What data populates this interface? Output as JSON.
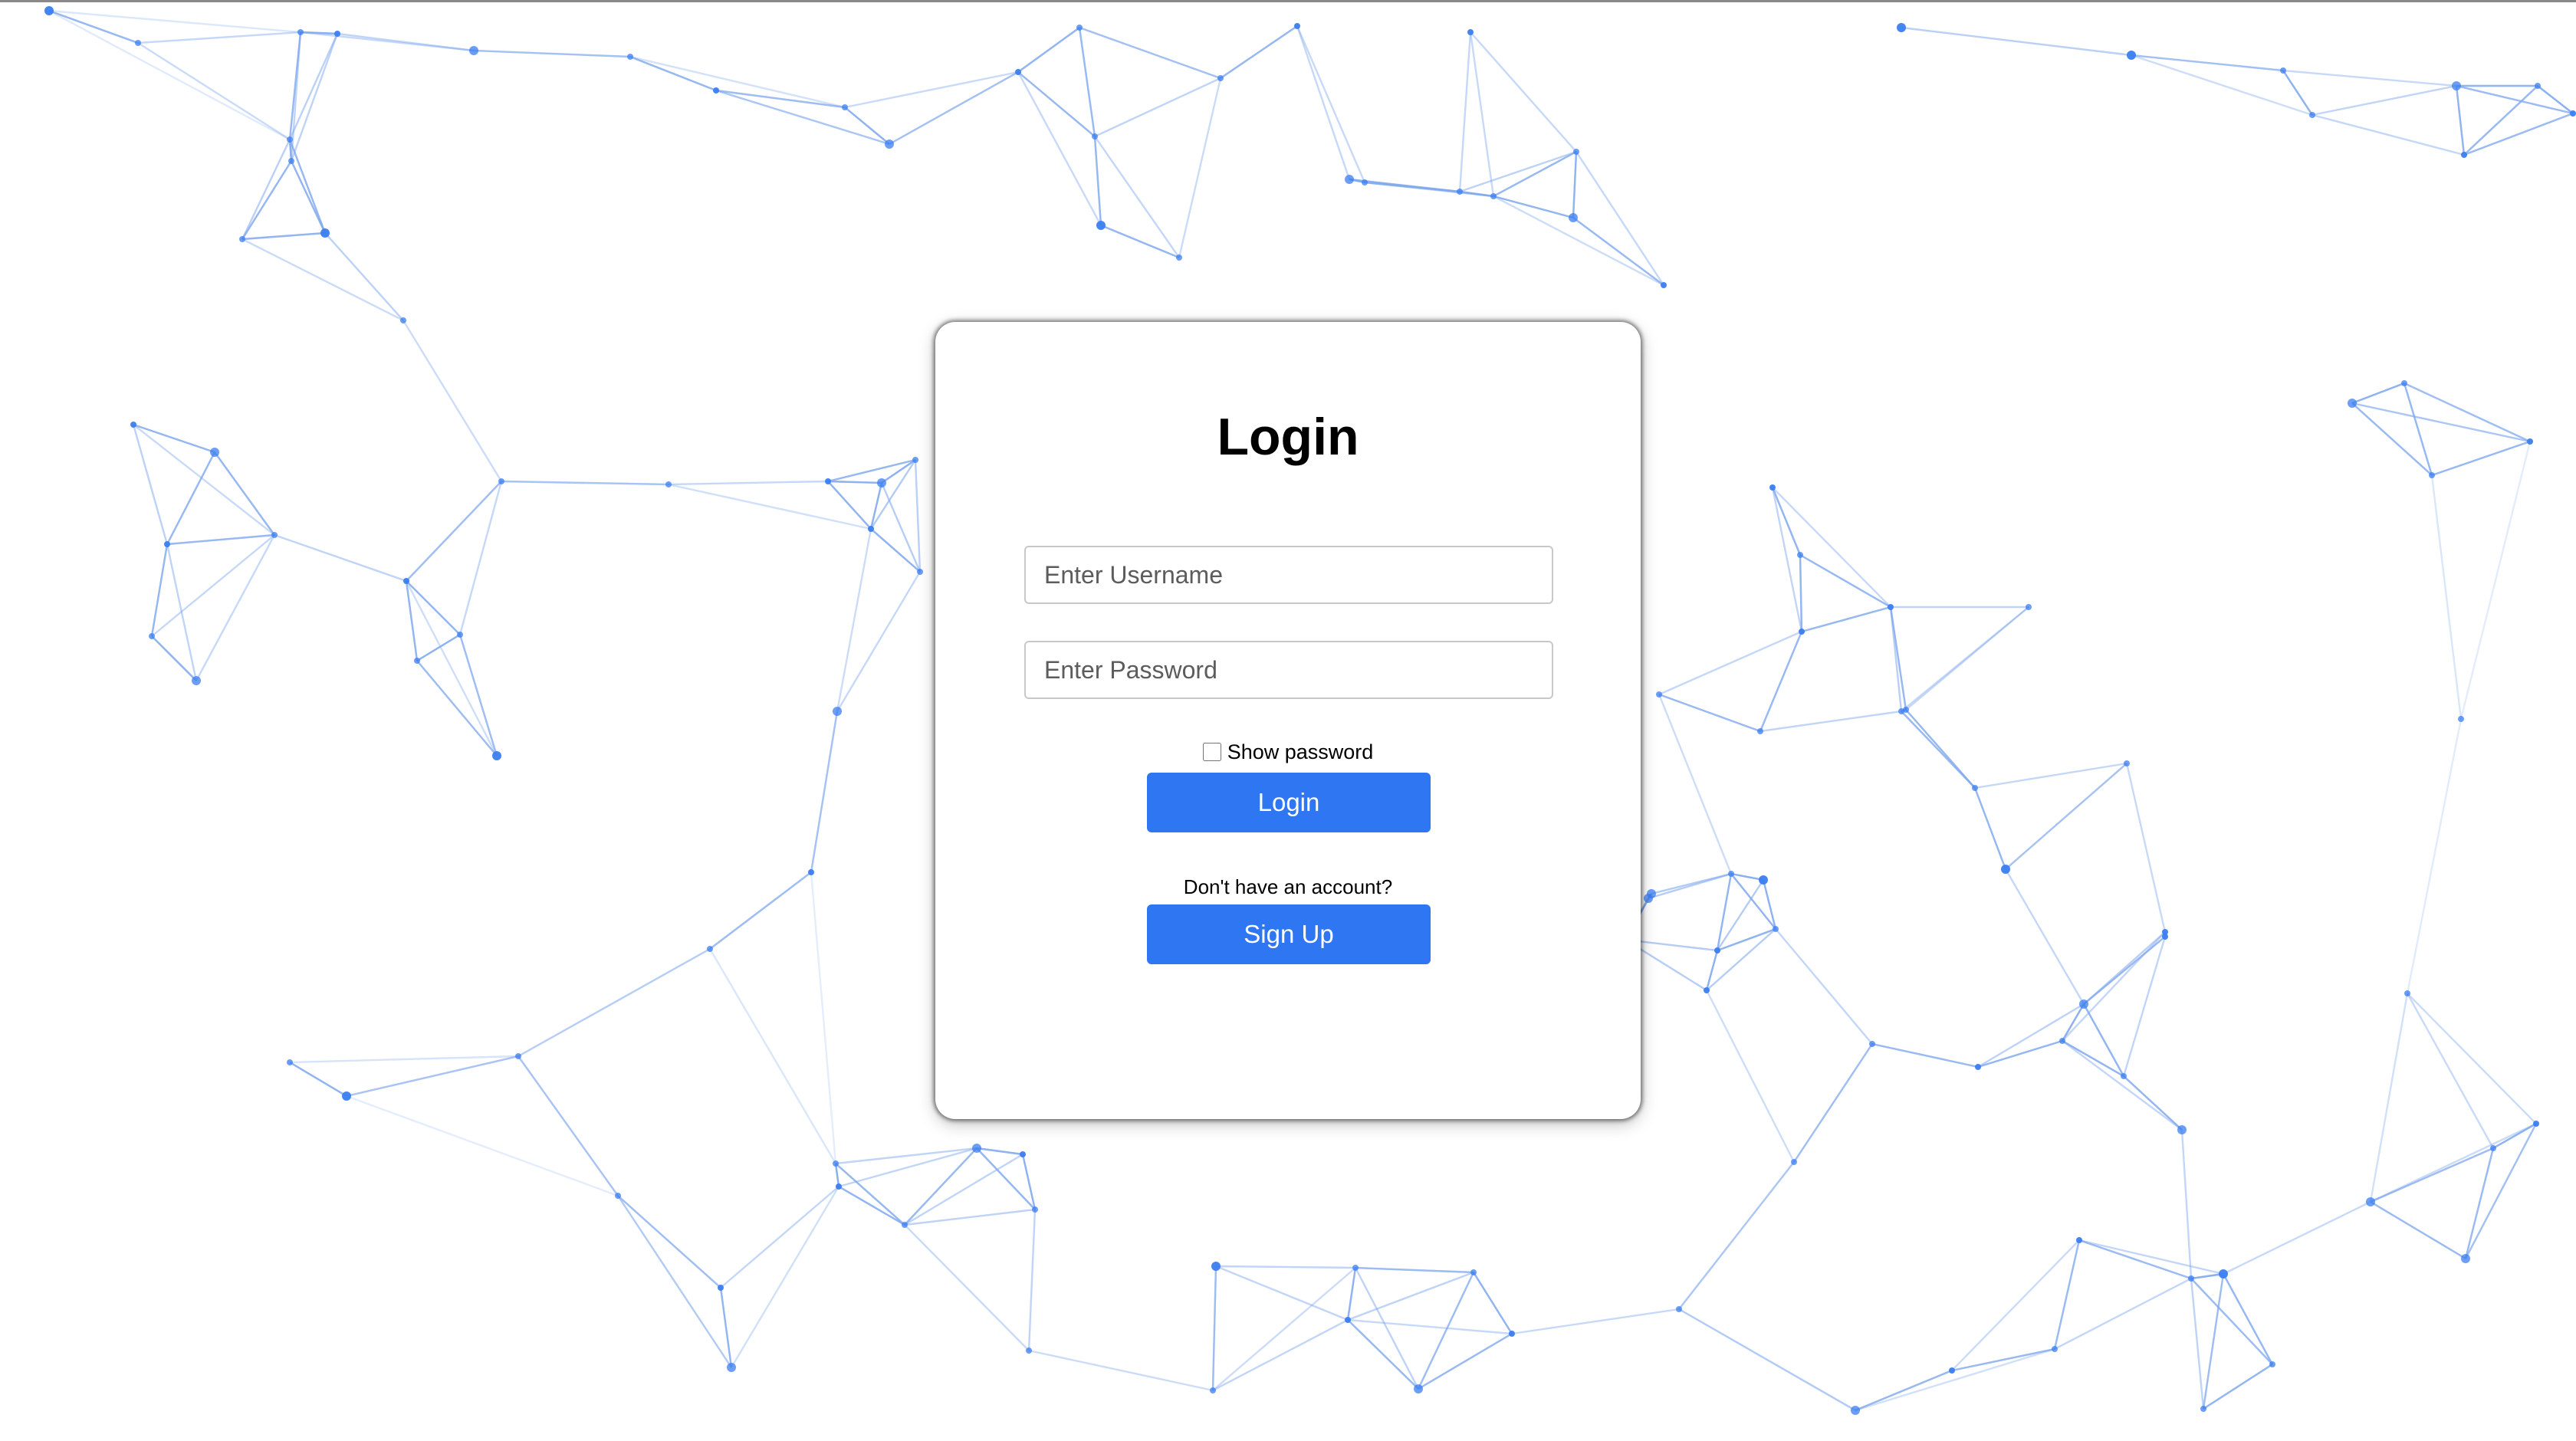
{
  "colors": {
    "accent": "#2f76f2",
    "network_node": "#3b7ef0",
    "network_line": "#7fa8ee",
    "background": "#ffffff"
  },
  "login_card": {
    "title": "Login",
    "username_placeholder": "Enter Username",
    "password_placeholder": "Enter Password",
    "show_password_label": "Show password",
    "login_button_label": "Login",
    "account_prompt": "Don't have an account?",
    "signup_button_label": "Sign Up"
  }
}
